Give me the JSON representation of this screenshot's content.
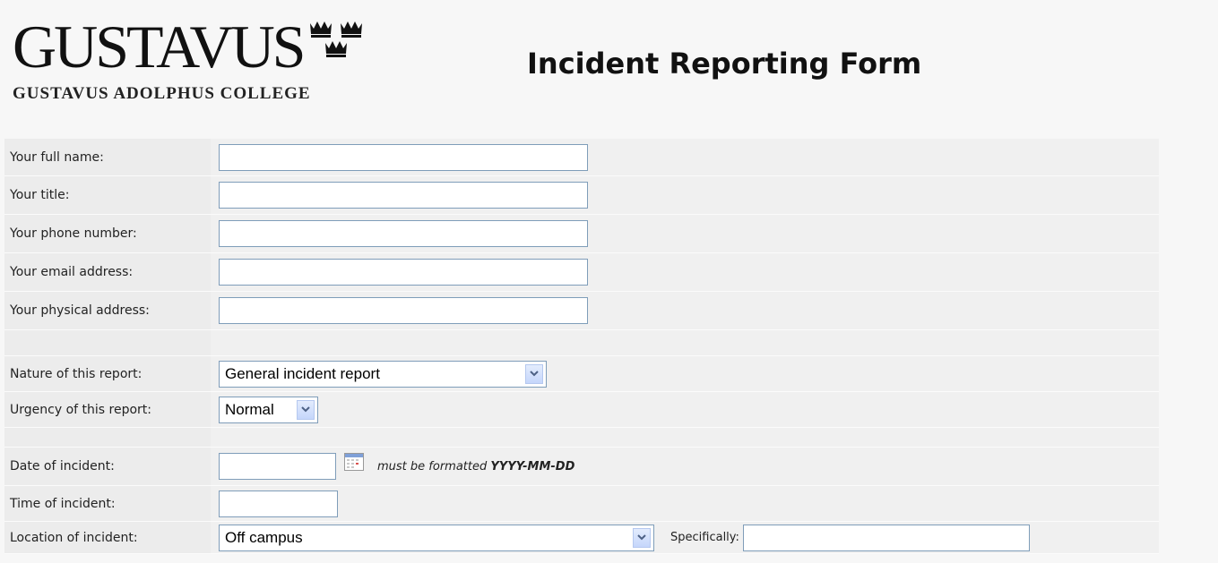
{
  "header": {
    "logo_word": "GUSTAVUS",
    "logo_subtitle": "GUSTAVUS ADOLPHUS COLLEGE",
    "page_title": "Incident Reporting Form"
  },
  "form": {
    "full_name_label": "Your full name:",
    "full_name_value": "",
    "title_label": "Your title:",
    "title_value": "",
    "phone_label": "Your phone number:",
    "phone_value": "",
    "email_label": "Your email address:",
    "email_value": "",
    "address_label": "Your physical address:",
    "address_value": "",
    "nature_label": "Nature of this report:",
    "nature_value": "General incident report",
    "urgency_label": "Urgency of this report:",
    "urgency_value": "Normal",
    "date_label": "Date of incident:",
    "date_value": "",
    "date_note_prefix": "must be formatted",
    "date_note_format": "YYYY-MM-DD",
    "time_label": "Time of incident:",
    "time_value": "",
    "location_label": "Location of incident:",
    "location_value": "Off campus",
    "specifically_label": "Specifically:",
    "specifically_value": ""
  }
}
